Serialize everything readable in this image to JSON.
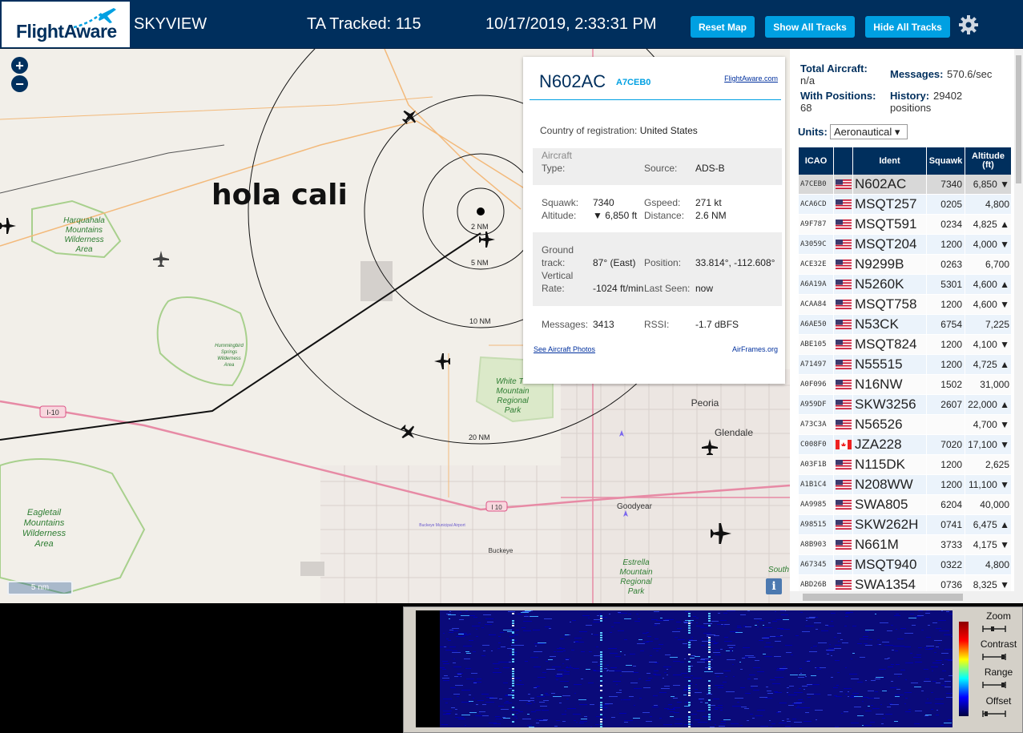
{
  "header": {
    "logo_text": "FlightAware",
    "site_name": "SKYVIEW",
    "tracked": "TA Tracked: 115",
    "datetime": "10/17/2019, 2:33:31 PM",
    "buttons": {
      "reset": "Reset Map",
      "show": "Show All Tracks",
      "hide": "Hide All Tracks"
    },
    "settings_icon": "gear-icon"
  },
  "map": {
    "zoom_in": "+",
    "zoom_out": "−",
    "scale_label": "5 nm",
    "info_label": "i",
    "overlay_text": "hola cali",
    "range_labels": [
      "2 NM",
      "5 NM",
      "10 NM",
      "20 NM"
    ],
    "place_labels": {
      "harquahala": "Harquahala Mountains Wilderness Area",
      "hummingbird": "Hummingbird Springs Wilderness Area",
      "white_tank": "White Tank Mountain Regional Park",
      "eagletail": "Eagletail Mountains Wilderness Area",
      "estrella": "Estrella Mountain Regional Park",
      "peoria": "Peoria",
      "glendale": "Glendale",
      "goodyear": "Goodyear",
      "buckeye": "Buckeye",
      "buckeye_airport": "Buckeye Municipal Airport",
      "south": "South",
      "i10": "I-10",
      "i10_b": "I 10"
    }
  },
  "popup": {
    "ident": "N602AC",
    "icao": "A7CEB0",
    "flightaware_link": "FlightAware.com",
    "country_label": "Country of registration:",
    "country_value": "United States",
    "aircraft_type_label1": "Aircraft",
    "aircraft_type_label2": "Type:",
    "source_label": "Source:",
    "source_value": "ADS-B",
    "squawk_label": "Squawk:",
    "squawk_value": "7340",
    "altitude_label": "Altitude:",
    "altitude_value": "▼ 6,850 ft",
    "gspeed_label": "Gspeed:",
    "gspeed_value": "271 kt",
    "distance_label": "Distance:",
    "distance_value": "2.6 NM",
    "ground_label1": "Ground",
    "ground_label2": "track:",
    "ground_value": "87° (East)",
    "vert_label1": "Vertical",
    "vert_label2": "Rate:",
    "vert_value": "-1024 ft/min",
    "position_label": "Position:",
    "position_value": "33.814°, -112.608°",
    "lastseen_label": "Last Seen:",
    "lastseen_value": "now",
    "messages_label": "Messages:",
    "messages_value": "3413",
    "rssi_label": "RSSI:",
    "rssi_value": "-1.7 dBFS",
    "photos_link": "See Aircraft Photos",
    "airframes_link": "AirFrames.org"
  },
  "side": {
    "total_label": "Total Aircraft:",
    "total_value": "n/a",
    "messages_label": "Messages:",
    "messages_value": "570.6/sec",
    "positions_label": "With Positions:",
    "positions_value": "68",
    "history_label": "History:",
    "history_value": "29402 positions",
    "units_label": "Units:",
    "units_value": "Aeronautical ▾",
    "columns": [
      "ICAO",
      "",
      "Ident",
      "Squawk",
      "Altitude (ft)"
    ],
    "rows": [
      {
        "icao": "A7CEB0",
        "flag": "us",
        "ident": "N602AC",
        "squawk": "7340",
        "alt": "6,850 ▼",
        "selected": true
      },
      {
        "icao": "ACA6CD",
        "flag": "us",
        "ident": "MSQT257",
        "squawk": "0205",
        "alt": "4,800"
      },
      {
        "icao": "A9F787",
        "flag": "us",
        "ident": "MSQT591",
        "squawk": "0234",
        "alt": "4,825 ▲"
      },
      {
        "icao": "A3059C",
        "flag": "us",
        "ident": "MSQT204",
        "squawk": "1200",
        "alt": "4,000 ▼"
      },
      {
        "icao": "ACE32E",
        "flag": "us",
        "ident": "N9299B",
        "squawk": "0263",
        "alt": "6,700"
      },
      {
        "icao": "A6A19A",
        "flag": "us",
        "ident": "N5260K",
        "squawk": "5301",
        "alt": "4,600 ▲"
      },
      {
        "icao": "ACAA84",
        "flag": "us",
        "ident": "MSQT758",
        "squawk": "1200",
        "alt": "4,600 ▼"
      },
      {
        "icao": "A6AE50",
        "flag": "us",
        "ident": "N53CK",
        "squawk": "6754",
        "alt": "7,225"
      },
      {
        "icao": "ABE105",
        "flag": "us",
        "ident": "MSQT824",
        "squawk": "1200",
        "alt": "4,100 ▼"
      },
      {
        "icao": "A71497",
        "flag": "us",
        "ident": "N55515",
        "squawk": "1200",
        "alt": "4,725 ▲"
      },
      {
        "icao": "A0F096",
        "flag": "us",
        "ident": "N16NW",
        "squawk": "1502",
        "alt": "31,000"
      },
      {
        "icao": "A959DF",
        "flag": "us",
        "ident": "SKW3256",
        "squawk": "2607",
        "alt": "22,000 ▲"
      },
      {
        "icao": "A73C3A",
        "flag": "us",
        "ident": "N56526",
        "squawk": "",
        "alt": "4,700 ▼"
      },
      {
        "icao": "C008F0",
        "flag": "ca",
        "ident": "JZA228",
        "squawk": "7020",
        "alt": "17,100 ▼"
      },
      {
        "icao": "A03F1B",
        "flag": "us",
        "ident": "N115DK",
        "squawk": "1200",
        "alt": "2,625"
      },
      {
        "icao": "A1B1C4",
        "flag": "us",
        "ident": "N208WW",
        "squawk": "1200",
        "alt": "11,100 ▼"
      },
      {
        "icao": "AA9985",
        "flag": "us",
        "ident": "SWA805",
        "squawk": "6204",
        "alt": "40,000"
      },
      {
        "icao": "A98515",
        "flag": "us",
        "ident": "SKW262H",
        "squawk": "0741",
        "alt": "6,475 ▲"
      },
      {
        "icao": "A8B903",
        "flag": "us",
        "ident": "N661M",
        "squawk": "3733",
        "alt": "4,175 ▼"
      },
      {
        "icao": "A67345",
        "flag": "us",
        "ident": "MSQT940",
        "squawk": "0322",
        "alt": "4,800"
      },
      {
        "icao": "ABD26B",
        "flag": "us",
        "ident": "SWA1354",
        "squawk": "0736",
        "alt": "8,325 ▼"
      }
    ]
  },
  "spectrum": {
    "zoom": "Zoom",
    "contrast": "Contrast",
    "range": "Range",
    "offset": "Offset"
  },
  "colors": {
    "header_bg": "#002f5d",
    "button_bg": "#00a0e2",
    "accent": "#00a0e2"
  }
}
